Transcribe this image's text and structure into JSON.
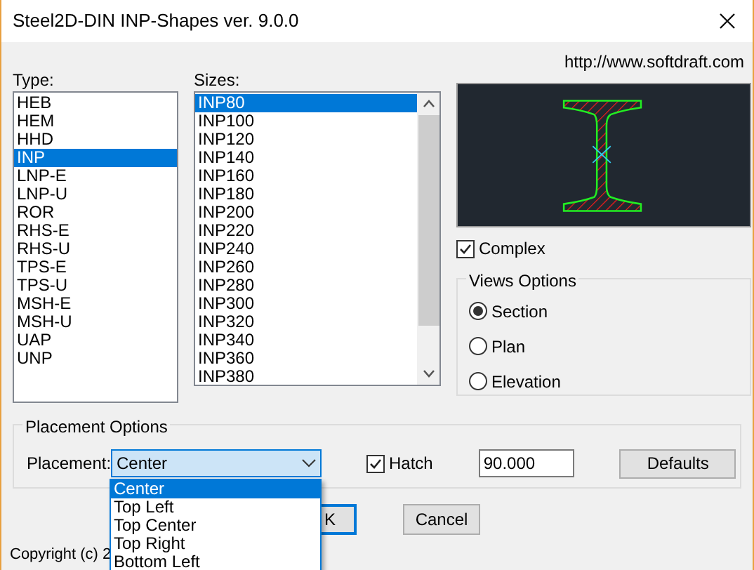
{
  "window": {
    "title": "Steel2D-DIN INP-Shapes ver. 9.0.0"
  },
  "url": "http://www.softdraft.com",
  "type_list": {
    "label": "Type:",
    "items": [
      {
        "label": "HEB",
        "selected": false
      },
      {
        "label": "HEM",
        "selected": false
      },
      {
        "label": "HHD",
        "selected": false
      },
      {
        "label": "INP",
        "selected": true
      },
      {
        "label": "LNP-E",
        "selected": false
      },
      {
        "label": "LNP-U",
        "selected": false
      },
      {
        "label": "ROR",
        "selected": false
      },
      {
        "label": "RHS-E",
        "selected": false
      },
      {
        "label": "RHS-U",
        "selected": false
      },
      {
        "label": "TPS-E",
        "selected": false
      },
      {
        "label": "TPS-U",
        "selected": false
      },
      {
        "label": "MSH-E",
        "selected": false
      },
      {
        "label": "MSH-U",
        "selected": false
      },
      {
        "label": "UAP",
        "selected": false
      },
      {
        "label": "UNP",
        "selected": false
      }
    ]
  },
  "sizes_list": {
    "label": "Sizes:",
    "items": [
      {
        "label": "INP80",
        "selected": true
      },
      {
        "label": "INP100",
        "selected": false
      },
      {
        "label": "INP120",
        "selected": false
      },
      {
        "label": "INP140",
        "selected": false
      },
      {
        "label": "INP160",
        "selected": false
      },
      {
        "label": "INP180",
        "selected": false
      },
      {
        "label": "INP200",
        "selected": false
      },
      {
        "label": "INP220",
        "selected": false
      },
      {
        "label": "INP240",
        "selected": false
      },
      {
        "label": "INP260",
        "selected": false
      },
      {
        "label": "INP280",
        "selected": false
      },
      {
        "label": "INP300",
        "selected": false
      },
      {
        "label": "INP320",
        "selected": false
      },
      {
        "label": "INP340",
        "selected": false
      },
      {
        "label": "INP360",
        "selected": false
      },
      {
        "label": "INP380",
        "selected": false
      }
    ]
  },
  "complex": {
    "label": "Complex",
    "checked": true
  },
  "views_options": {
    "title": "Views Options",
    "options": [
      {
        "label": "Section",
        "selected": true
      },
      {
        "label": "Plan",
        "selected": false
      },
      {
        "label": "Elevation",
        "selected": false
      }
    ]
  },
  "placement_options": {
    "title": "Placement Options",
    "placement": {
      "label": "Placement:",
      "value": "Center",
      "expanded": true,
      "options": [
        {
          "label": "Center",
          "selected": true
        },
        {
          "label": "Top Left",
          "selected": false
        },
        {
          "label": "Top Center",
          "selected": false
        },
        {
          "label": "Top Right",
          "selected": false
        },
        {
          "label": "Bottom Left",
          "selected": false
        }
      ]
    },
    "hatch": {
      "label": "Hatch",
      "checked": true
    },
    "angle_value": "90.000",
    "defaults_button": "Defaults"
  },
  "ok_button": "K",
  "cancel_button": "Cancel",
  "copyright": "Copyright (c) 2"
}
